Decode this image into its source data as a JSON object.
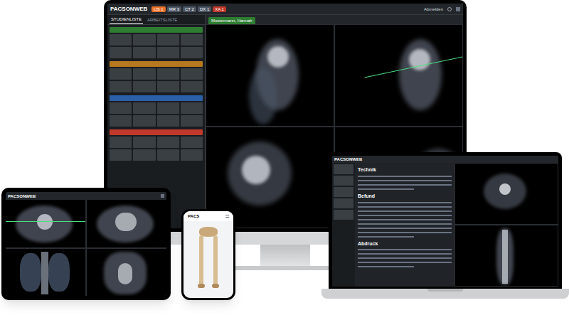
{
  "monitor": {
    "logo": "PACSONWEB",
    "modality_chips": [
      {
        "label": "US 1",
        "color": "#e8702a"
      },
      {
        "label": "MR 3",
        "color": "#4b5563"
      },
      {
        "label": "CT 2",
        "color": "#4b5563"
      },
      {
        "label": "DX 1",
        "color": "#4b5563"
      },
      {
        "label": "XA 1",
        "color": "#c0392b"
      }
    ],
    "user": "Abmelden",
    "sidebar_tabs": [
      {
        "label": "STUDIENLISTE",
        "selected": true
      },
      {
        "label": "ARBEITSLISTE",
        "selected": false
      }
    ],
    "study_groups": [
      {
        "color": "#2e7d32"
      },
      {
        "color": "#b7791f"
      },
      {
        "color": "#2b5fa8"
      },
      {
        "color": "#c0392b"
      }
    ],
    "viewer_tab": "Mustermann, Hannah"
  },
  "tablet": {
    "logo": "PACSONWEB"
  },
  "phone": {
    "logo": "PACS"
  },
  "laptop": {
    "logo": "PACSONWEB",
    "report": [
      {
        "heading": "Technik"
      },
      {
        "heading": "Befund"
      },
      {
        "heading": "Abdruck"
      }
    ]
  }
}
